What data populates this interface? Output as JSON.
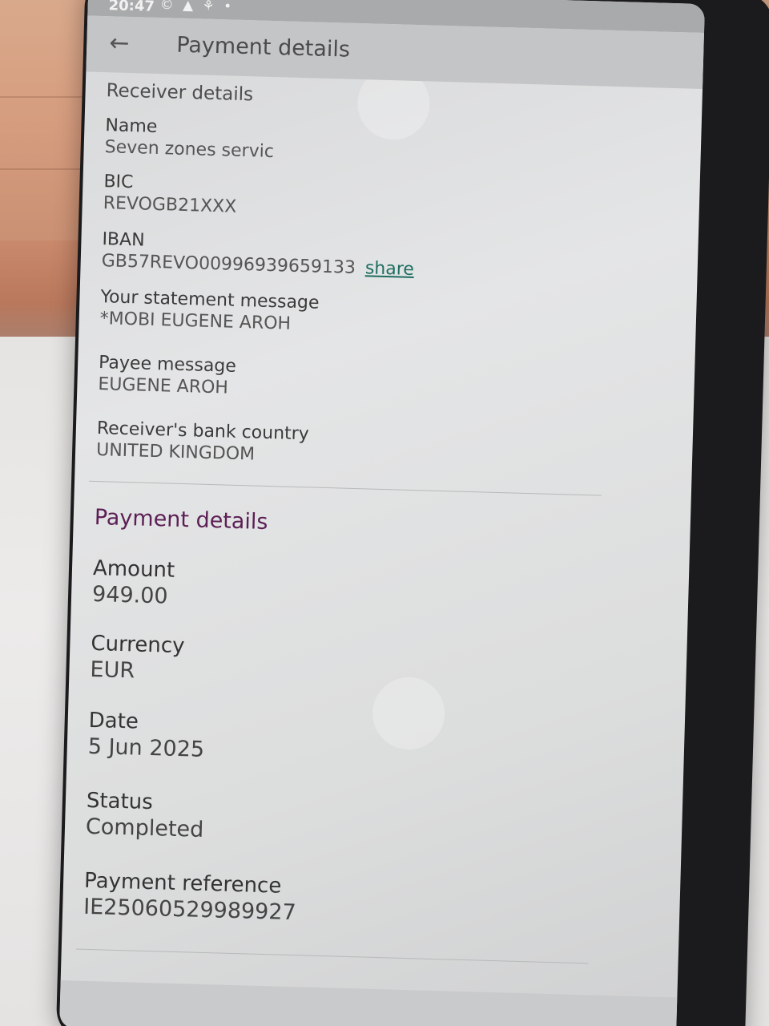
{
  "status_bar": {
    "time": "20:47",
    "icons": "© ▲ ⚘ •"
  },
  "app_bar": {
    "back_icon": "←",
    "title": "Payment details"
  },
  "receiver": {
    "section_title": "Receiver details",
    "name_label": "Name",
    "name_value": "Seven zones servic",
    "bic_label": "BIC",
    "bic_value": "REVOGB21XXX",
    "iban_label": "IBAN",
    "iban_value": "GB57REVO00996939659133",
    "share_label": "share",
    "statement_label": "Your statement message",
    "statement_value": "*MOBI EUGENE AROH",
    "payee_label": "Payee message",
    "payee_value": "EUGENE AROH",
    "country_label": "Receiver's bank country",
    "country_value": "UNITED KINGDOM"
  },
  "payment": {
    "section_title": "Payment details",
    "amount_label": "Amount",
    "amount_value": "949.00",
    "currency_label": "Currency",
    "currency_value": "EUR",
    "date_label": "Date",
    "date_value": "5 Jun 2025",
    "status_label": "Status",
    "status_value": "Completed",
    "reference_label": "Payment reference",
    "reference_value": "IE25060529989927"
  },
  "colors": {
    "section_accent": "#5c1f55",
    "link": "#1e6d61"
  }
}
